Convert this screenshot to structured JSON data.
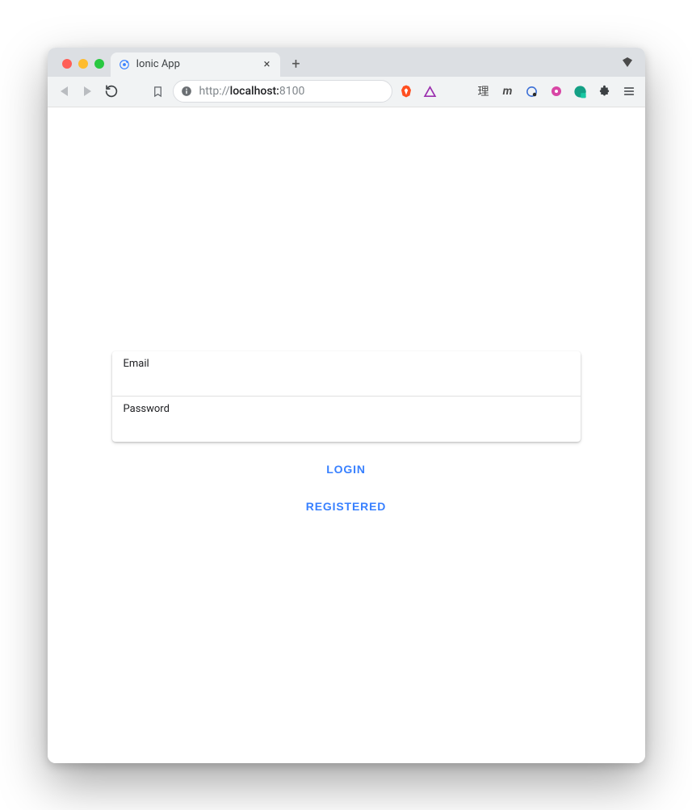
{
  "browser": {
    "tab_title": "Ionic App",
    "url_prefix": "http://",
    "url_host": "localhost:",
    "url_port": "8100",
    "right_glyphs": [
      "理",
      "m"
    ]
  },
  "form": {
    "email_label": "Email",
    "password_label": "Password"
  },
  "buttons": {
    "login": "LOGIN",
    "registered": "REGISTERED"
  }
}
